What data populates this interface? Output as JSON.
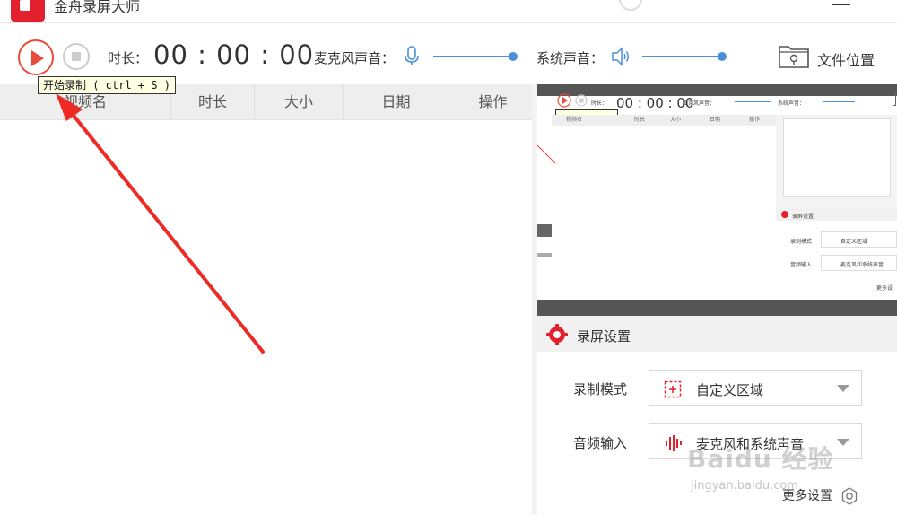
{
  "app": {
    "title": "金舟录屏大师"
  },
  "toolbar": {
    "duration_label": "时长：",
    "timer": "00 : 00 : 00",
    "mic_label": "麦克风声音：",
    "system_label": "系统声音：",
    "file_location": "文件位置"
  },
  "tooltip": {
    "text": "开始录制 ( ctrl + S )"
  },
  "table": {
    "columns": [
      "视频名",
      "时长",
      "大小",
      "日期",
      "操作"
    ]
  },
  "preview": {
    "timer": "00 : 00 : 00",
    "duration_label": "时长：",
    "mic_label": "麦克风声音：",
    "system_label": "系统声音：",
    "columns": [
      "视频名",
      "时长",
      "大小",
      "日期",
      "操作"
    ],
    "settings_title": "录屏设置",
    "mode_label": "录制模式",
    "mode_value": "自定义区域",
    "audio_label": "音频输入",
    "audio_value": "麦克风和系统声音",
    "more": "更多设"
  },
  "settings": {
    "title": "录屏设置",
    "mode_label": "录制模式",
    "mode_value": "自定义区域",
    "audio_label": "音频输入",
    "audio_value": "麦克风和系统声音",
    "more_settings": "更多设置"
  },
  "watermark": {
    "main": "Baidu 经验",
    "sub": "jingyan.baidu.com"
  },
  "colors": {
    "accent_red": "#e74c3c",
    "slider_blue": "#4a90d9",
    "brand_red": "#e3202e"
  }
}
